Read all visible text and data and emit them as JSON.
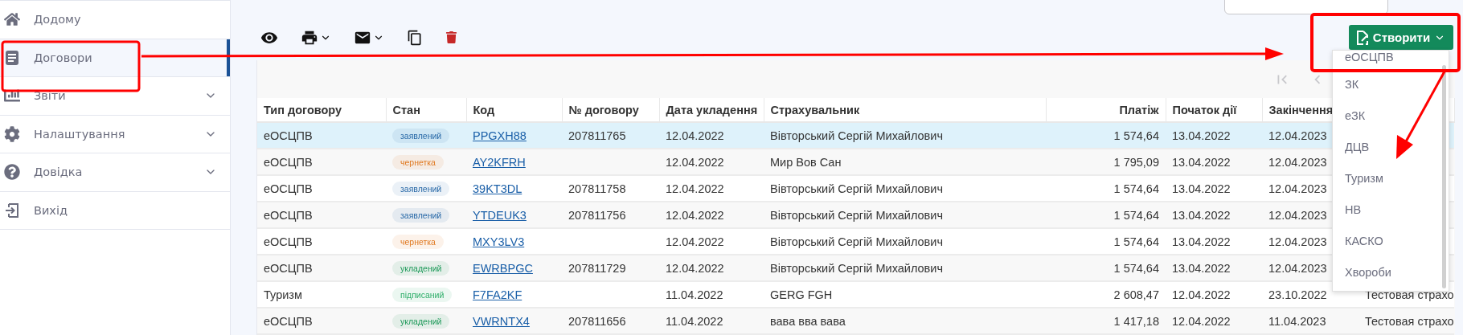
{
  "sidebar": {
    "items": [
      {
        "label": "Додому",
        "selected": false,
        "expandable": false
      },
      {
        "label": "Договори",
        "selected": true,
        "expandable": false
      },
      {
        "label": "Звіти",
        "selected": false,
        "expandable": true
      },
      {
        "label": "Налаштування",
        "selected": false,
        "expandable": true
      },
      {
        "label": "Довідка",
        "selected": false,
        "expandable": true
      },
      {
        "label": "Вихід",
        "selected": false,
        "expandable": false
      }
    ]
  },
  "toolbar": {
    "create_button": "Створити",
    "create_menu": [
      "еОСЦПВ",
      "ЗК",
      "еЗК",
      "ДЦВ",
      "Туризм",
      "НВ",
      "КАСКО",
      "Хвороби"
    ]
  },
  "table": {
    "columns": [
      "Тип договору",
      "Стан",
      "Код",
      "№ договору",
      "Дата укладення",
      "Страхувальник",
      "Платіж",
      "Початок дії",
      "Закінчення"
    ],
    "rows": [
      {
        "selected": true,
        "type": "еОСЦПВ",
        "status": {
          "text": "заявлений",
          "color": "#2a6aa8"
        },
        "code": "PPGXH88",
        "number": "207811765",
        "date": "12.04.2022",
        "insurer": "Вівторський Сергій Михайлович",
        "payment": "1 574,64",
        "start": "13.04.2022",
        "end": "12.04.2023"
      },
      {
        "selected": false,
        "type": "еОСЦПВ",
        "status": {
          "text": "чернетка",
          "color": "#e07a22"
        },
        "code": "AY2KFRH",
        "date": "12.04.2022",
        "insurer": "Мир Вов Сан",
        "payment": "1 795,09",
        "start": "13.04.2022",
        "end": "12.04.2023"
      },
      {
        "selected": false,
        "type": "еОСЦПВ",
        "status": {
          "text": "заявлений",
          "color": "#2a6aa8"
        },
        "code": "39KT3DL",
        "number": "207811758",
        "date": "12.04.2022",
        "insurer": "Вівторський Сергій Михайлович",
        "payment": "1 574,64",
        "start": "13.04.2022",
        "end": "12.04.2023"
      },
      {
        "selected": false,
        "type": "еОСЦПВ",
        "status": {
          "text": "заявлений",
          "color": "#2a6aa8"
        },
        "code": "YTDEUK3",
        "number": "207811756",
        "date": "12.04.2022",
        "insurer": "Вівторський Сергій Михайлович",
        "payment": "1 574,64",
        "start": "13.04.2022",
        "end": "12.04.2023"
      },
      {
        "selected": false,
        "type": "еОСЦПВ",
        "status": {
          "text": "чернетка",
          "color": "#e07a22"
        },
        "code": "MXY3LV3",
        "date": "12.04.2022",
        "insurer": "Вівторський Сергій Михайлович",
        "payment": "1 574,64",
        "start": "13.04.2022",
        "end": "12.04.2023"
      },
      {
        "selected": false,
        "type": "еОСЦПВ",
        "status": {
          "text": "укладений",
          "color": "#1e9a5a"
        },
        "code": "EWRBPGC",
        "number": "207811729",
        "date": "12.04.2022",
        "insurer": "Вівторський Сергій Михайлович",
        "payment": "1 574,64",
        "start": "13.04.2022",
        "end": "12.04.2023"
      },
      {
        "selected": false,
        "type": "Туризм",
        "status": {
          "text": "підписаний",
          "color": "#2fae6a"
        },
        "code": "F7FA2KF",
        "date": "11.04.2022",
        "insurer": "GERG FGH",
        "payment": "2 608,47",
        "start": "12.04.2022",
        "end": "23.10.2022",
        "column_10": "Тестовая страхо"
      },
      {
        "selected": false,
        "type": "еОСЦПВ",
        "status": {
          "text": "укладений",
          "color": "#1e9a5a"
        },
        "code": "VWRNTX4",
        "number": "207811656",
        "date": "11.04.2022",
        "insurer": "вава вва вава",
        "payment": "1 417,18",
        "start": "12.04.2022",
        "end": "11.04.2023",
        "column_10": "Тестовая страхо"
      }
    ]
  }
}
